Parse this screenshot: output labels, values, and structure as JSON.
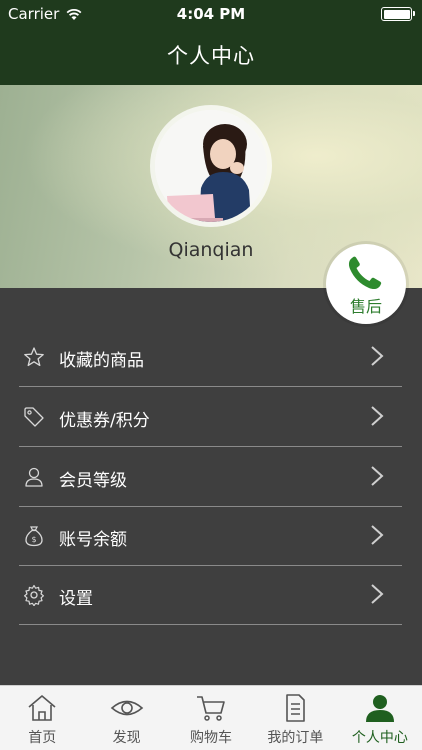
{
  "status_bar": {
    "carrier": "Carrier",
    "time": "4:04 PM"
  },
  "nav": {
    "title": "个人中心"
  },
  "profile": {
    "username": "Qianqian"
  },
  "after_sales": {
    "label": "售后",
    "icon": "phone-icon"
  },
  "menu": {
    "items": [
      {
        "label": "收藏的商品",
        "icon": "star-icon"
      },
      {
        "label": "优惠券/积分",
        "icon": "tag-icon"
      },
      {
        "label": "会员等级",
        "icon": "user-icon"
      },
      {
        "label": "账号余额",
        "icon": "money-bag-icon"
      },
      {
        "label": "设置",
        "icon": "gear-icon"
      }
    ]
  },
  "tabbar": {
    "tabs": [
      {
        "label": "首页",
        "icon": "home-icon"
      },
      {
        "label": "发现",
        "icon": "eye-icon"
      },
      {
        "label": "购物车",
        "icon": "cart-icon"
      },
      {
        "label": "我的订单",
        "icon": "document-icon"
      },
      {
        "label": "个人中心",
        "icon": "person-icon",
        "active": true
      }
    ]
  },
  "colors": {
    "nav_bg": "#1f3a1d",
    "menu_bg": "#3f3f3f",
    "accent_green": "#2e7d2e"
  }
}
